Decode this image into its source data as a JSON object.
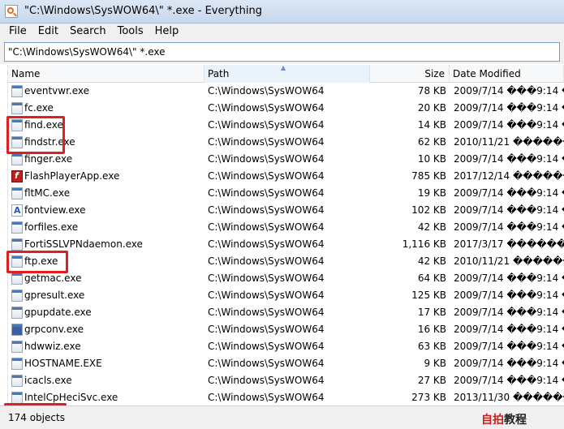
{
  "window": {
    "title": "\"C:\\Windows\\SysWOW64\\\" *.exe - Everything"
  },
  "menu": [
    "File",
    "Edit",
    "Search",
    "Tools",
    "Help"
  ],
  "search": {
    "value": "\"C:\\Windows\\SysWOW64\\\" *.exe"
  },
  "columns": {
    "name": "Name",
    "path": "Path",
    "size": "Size",
    "date": "Date Modified"
  },
  "rows": [
    {
      "name": "eventvwr.exe",
      "path": "C:\\Windows\\SysWOW64",
      "size": "78 KB",
      "date": "2009/7/14 ���9:14 �J"
    },
    {
      "name": "fc.exe",
      "path": "C:\\Windows\\SysWOW64",
      "size": "20 KB",
      "date": "2009/7/14 ���9:14 �J"
    },
    {
      "name": "find.exe",
      "path": "C:\\Windows\\SysWOW64",
      "size": "14 KB",
      "date": "2009/7/14 ���9:14 �J"
    },
    {
      "name": "findstr.exe",
      "path": "C:\\Windows\\SysWOW64",
      "size": "62 KB",
      "date": "2010/11/21 ������ 11:"
    },
    {
      "name": "finger.exe",
      "path": "C:\\Windows\\SysWOW64",
      "size": "10 KB",
      "date": "2009/7/14 ���9:14 �J"
    },
    {
      "name": "FlashPlayerApp.exe",
      "path": "C:\\Windows\\SysWOW64",
      "size": "785 KB",
      "date": "2017/12/14 ������ 10:"
    },
    {
      "name": "fltMC.exe",
      "path": "C:\\Windows\\SysWOW64",
      "size": "19 KB",
      "date": "2009/7/14 ���9:14 �J"
    },
    {
      "name": "fontview.exe",
      "path": "C:\\Windows\\SysWOW64",
      "size": "102 KB",
      "date": "2009/7/14 ���9:14 �J"
    },
    {
      "name": "forfiles.exe",
      "path": "C:\\Windows\\SysWOW64",
      "size": "42 KB",
      "date": "2009/7/14 ���9:14 �J"
    },
    {
      "name": "FortiSSLVPNdaemon.exe",
      "path": "C:\\Windows\\SysWOW64",
      "size": "1,116 KB",
      "date": "2017/3/17 ������ 15:29"
    },
    {
      "name": "ftp.exe",
      "path": "C:\\Windows\\SysWOW64",
      "size": "42 KB",
      "date": "2010/11/21 ������ 11:"
    },
    {
      "name": "getmac.exe",
      "path": "C:\\Windows\\SysWOW64",
      "size": "64 KB",
      "date": "2009/7/14 ���9:14 �J"
    },
    {
      "name": "gpresult.exe",
      "path": "C:\\Windows\\SysWOW64",
      "size": "125 KB",
      "date": "2009/7/14 ���9:14 �J"
    },
    {
      "name": "gpupdate.exe",
      "path": "C:\\Windows\\SysWOW64",
      "size": "17 KB",
      "date": "2009/7/14 ���9:14 �J"
    },
    {
      "name": "grpconv.exe",
      "path": "C:\\Windows\\SysWOW64",
      "size": "16 KB",
      "date": "2009/7/14 ���9:14 �J"
    },
    {
      "name": "hdwwiz.exe",
      "path": "C:\\Windows\\SysWOW64",
      "size": "63 KB",
      "date": "2009/7/14 ���9:14 �J"
    },
    {
      "name": "HOSTNAME.EXE",
      "path": "C:\\Windows\\SysWOW64",
      "size": "9 KB",
      "date": "2009/7/14 ���9:14 �J"
    },
    {
      "name": "icacls.exe",
      "path": "C:\\Windows\\SysWOW64",
      "size": "27 KB",
      "date": "2009/7/14 ���9:14 �J"
    },
    {
      "name": "IntelCpHeciSvc.exe",
      "path": "C:\\Windows\\SysWOW64",
      "size": "273 KB",
      "date": "2013/11/30 ������ 14:"
    }
  ],
  "status": {
    "text": "174 objects"
  },
  "logo": {
    "red": "自拍",
    "black": "教程"
  }
}
